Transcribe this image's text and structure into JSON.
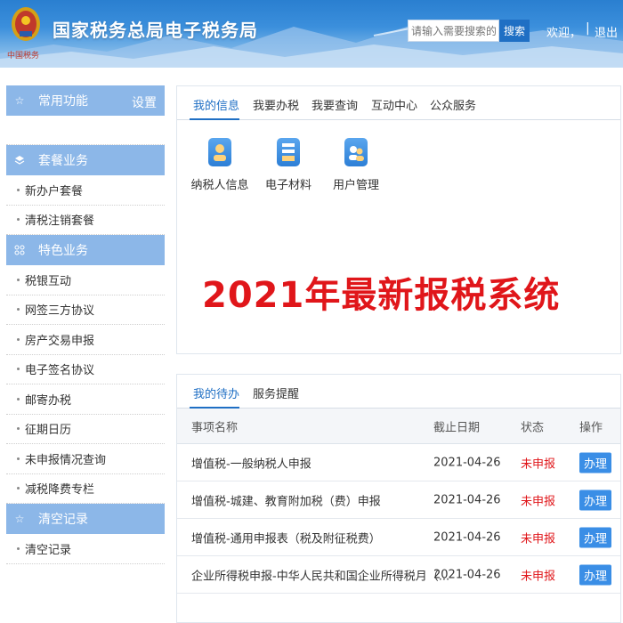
{
  "header": {
    "emblem_caption": "中国税务",
    "title": "国家税务总局电子税务局",
    "search_placeholder": "请输入需要搜索的内",
    "search_button": "搜索",
    "welcome": "欢迎，",
    "separator": "|",
    "logout": "退出"
  },
  "sidebar": {
    "common": {
      "label": "常用功能",
      "setting": "设置"
    },
    "package": {
      "label": "套餐业务",
      "items": [
        "新办户套餐",
        "清税注销套餐"
      ]
    },
    "special": {
      "label": "特色业务",
      "items": [
        "税银互动",
        "网签三方协议",
        "房产交易申报",
        "电子签名协议",
        "邮寄办税",
        "征期日历",
        "未申报情况查询",
        "减税降费专栏"
      ]
    },
    "clear": {
      "label": "清空记录",
      "items": [
        "清空记录"
      ]
    }
  },
  "top_panel": {
    "tabs": [
      "我的信息",
      "我要办税",
      "我要查询",
      "互动中心",
      "公众服务"
    ],
    "apps": [
      {
        "label": "纳税人信息",
        "icon": "user-card-icon"
      },
      {
        "label": "电子材料",
        "icon": "document-stack-icon"
      },
      {
        "label": "用户管理",
        "icon": "users-icon"
      }
    ],
    "promo": "2021年最新报税系统"
  },
  "bottom_panel": {
    "tabs": [
      "我的待办",
      "服务提醒"
    ],
    "columns": [
      "事项名称",
      "截止日期",
      "状态",
      "操作"
    ],
    "rows": [
      {
        "name": "增值税-一般纳税人申报",
        "date": "2021-04-26",
        "status": "未申报",
        "op": "办理"
      },
      {
        "name": "增值税-城建、教育附加税（费）申报",
        "date": "2021-04-26",
        "status": "未申报",
        "op": "办理"
      },
      {
        "name": "增值税-通用申报表（税及附征税费）",
        "date": "2021-04-26",
        "status": "未申报",
        "op": "办理"
      },
      {
        "name": "企业所得税申报-中华人民共和国企业所得税月（...",
        "date": "2021-04-26",
        "status": "未申报",
        "op": "办理"
      }
    ]
  },
  "colors": {
    "brand_blue": "#1f6fc4",
    "sidebar_head": "#8cb7e8",
    "status_red": "#e0161a",
    "op_button": "#3a8ee6"
  }
}
